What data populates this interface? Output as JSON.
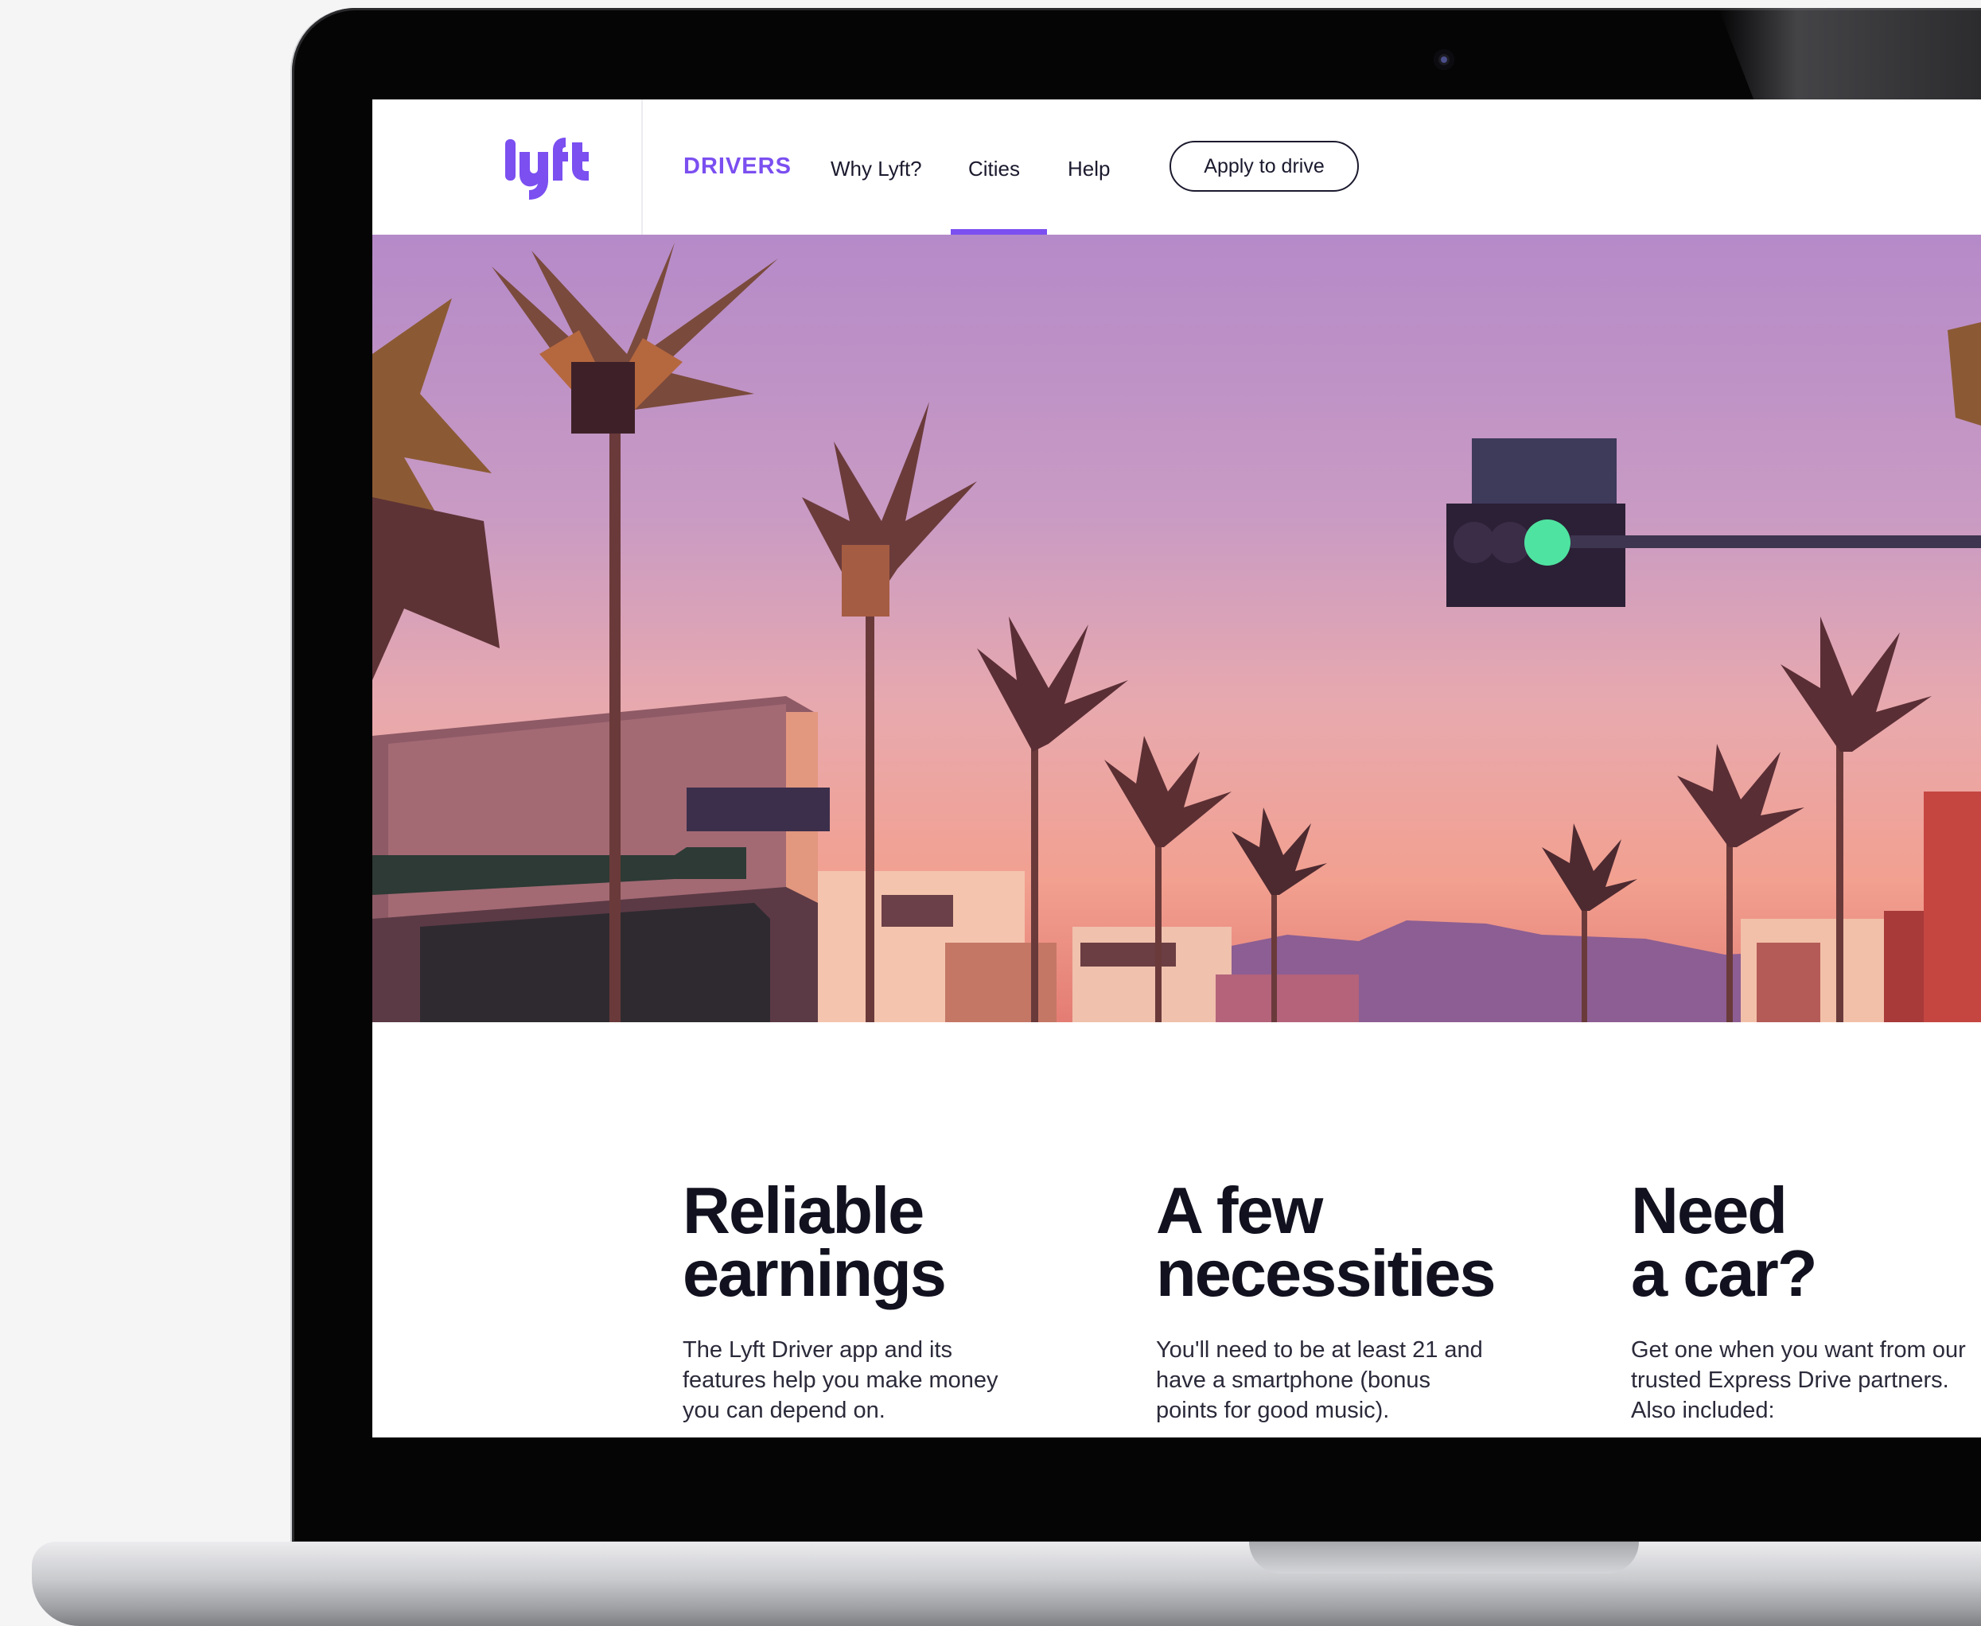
{
  "colors": {
    "accent": "#7b4ff0",
    "text": "#11111f",
    "traffic_light_green": "#4fe3a1"
  },
  "nav": {
    "logo_icon": "lyft-logo",
    "brand_label": "DRIVERS",
    "items": [
      {
        "label": "Why Lyft?"
      },
      {
        "label": "Cities",
        "active": true
      },
      {
        "label": "Help"
      }
    ],
    "cta_label": "Apply to drive"
  },
  "hero": {
    "description_icon": "palm-trees-sunset-illustration"
  },
  "features": [
    {
      "title_line1": "Reliable",
      "title_line2": "earnings",
      "body": "The Lyft Driver app and its features help you make money you can depend on."
    },
    {
      "title_line1": "A few",
      "title_line2": "necessities",
      "body": "You'll need to be at least 21 and have a smartphone (bonus points for good music)."
    },
    {
      "title_line1": "Need",
      "title_line2": "a car?",
      "body": "Get one when you want from our trusted Express Drive partners. Also included:"
    }
  ]
}
